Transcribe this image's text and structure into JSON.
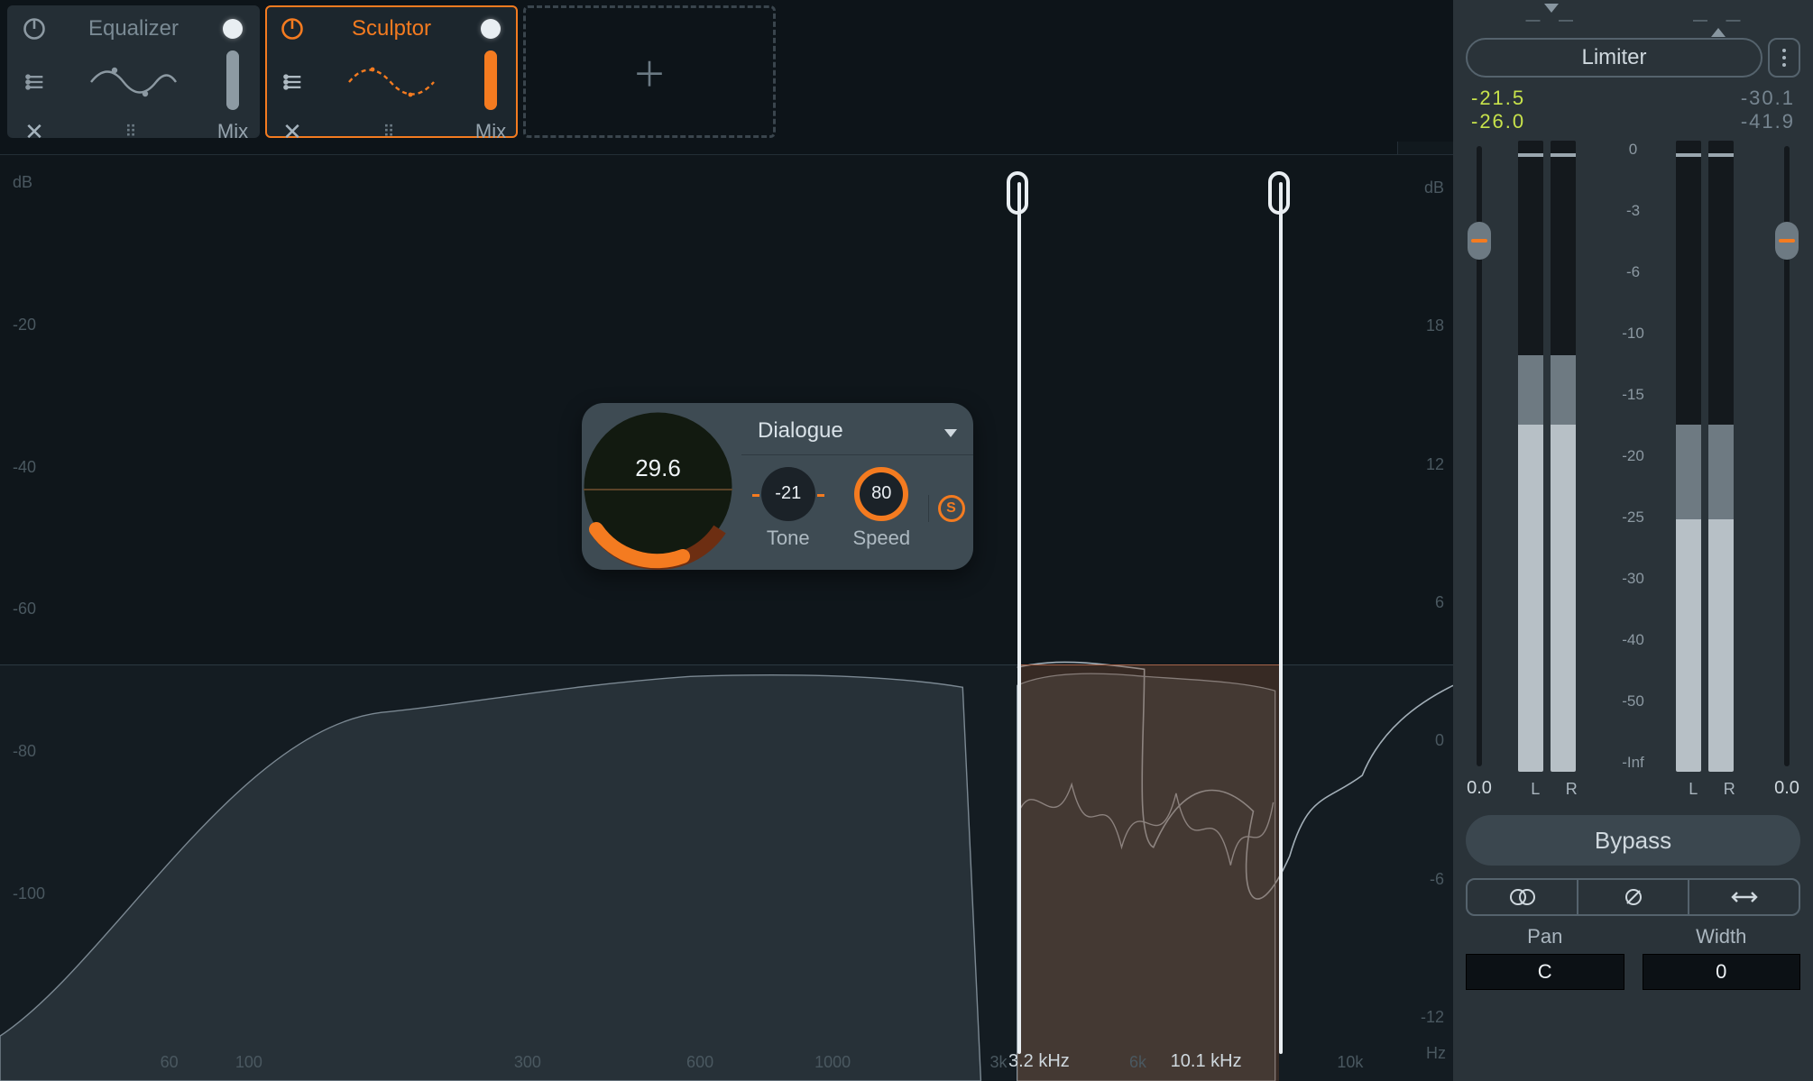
{
  "modules": [
    {
      "name": "Equalizer",
      "active": false,
      "mix_label": "Mix",
      "mix_fill_pct": 100
    },
    {
      "name": "Sculptor",
      "active": true,
      "mix_label": "Mix",
      "mix_fill_pct": 100
    }
  ],
  "spectrum": {
    "db_left_unit": "dB",
    "db_left_ticks": [
      "-20",
      "-40",
      "-60",
      "-80",
      "-100"
    ],
    "db_right_unit": "dB",
    "db_right_ticks": [
      "18",
      "12",
      "6",
      "0",
      "-6",
      "-12"
    ],
    "hz_ticks": [
      {
        "label": "60",
        "pct": 8
      },
      {
        "label": "100",
        "pct": 14
      },
      {
        "label": "300",
        "pct": 35
      },
      {
        "label": "600",
        "pct": 48
      },
      {
        "label": "1000",
        "pct": 58
      },
      {
        "label": "3k",
        "pct": 80
      },
      {
        "label": "6k",
        "pct": 90
      },
      {
        "label": "10k",
        "pct": 97
      }
    ],
    "hz_unit": "Hz",
    "band": {
      "low_pct": 70,
      "high_pct": 88,
      "low_label": "3.2 kHz",
      "high_label": "10.1 kHz"
    }
  },
  "popup": {
    "main_value": "29.6",
    "preset": "Dialogue",
    "tone": {
      "value": "-21",
      "label": "Tone"
    },
    "speed": {
      "value": "80",
      "label": "Speed"
    },
    "solo": "S"
  },
  "sidebar": {
    "title": "Limiter",
    "readouts": {
      "in_peak": "-21.5",
      "in_rms": "-26.0",
      "out_peak": "-30.1",
      "out_rms": "-41.9"
    },
    "db_ladder": [
      "0",
      "-3",
      "-6",
      "-10",
      "-15",
      "-20",
      "-25",
      "-30",
      "-40",
      "-50",
      "-Inf"
    ],
    "slider_left_value": "0.0",
    "slider_right_value": "0.0",
    "meters": {
      "in": {
        "L": {
          "tip_pct": 2,
          "peak_pct": 34,
          "dark_top_pct": 34,
          "dark_bot_pct": 45,
          "light_top_pct": 45
        },
        "R": {
          "tip_pct": 2,
          "peak_pct": 34,
          "dark_top_pct": 34,
          "dark_bot_pct": 45,
          "light_top_pct": 45
        }
      },
      "out": {
        "L": {
          "tip_pct": 2,
          "peak_pct": 45,
          "dark_top_pct": 45,
          "dark_bot_pct": 60,
          "light_top_pct": 60
        },
        "R": {
          "tip_pct": 2,
          "peak_pct": 45,
          "dark_top_pct": 45,
          "dark_bot_pct": 60,
          "light_top_pct": 60
        }
      }
    },
    "lr_labels": {
      "l": "L",
      "r": "R"
    },
    "bypass": "Bypass",
    "pan": {
      "label": "Pan",
      "value": "C"
    },
    "width": {
      "label": "Width",
      "value": "0"
    }
  }
}
